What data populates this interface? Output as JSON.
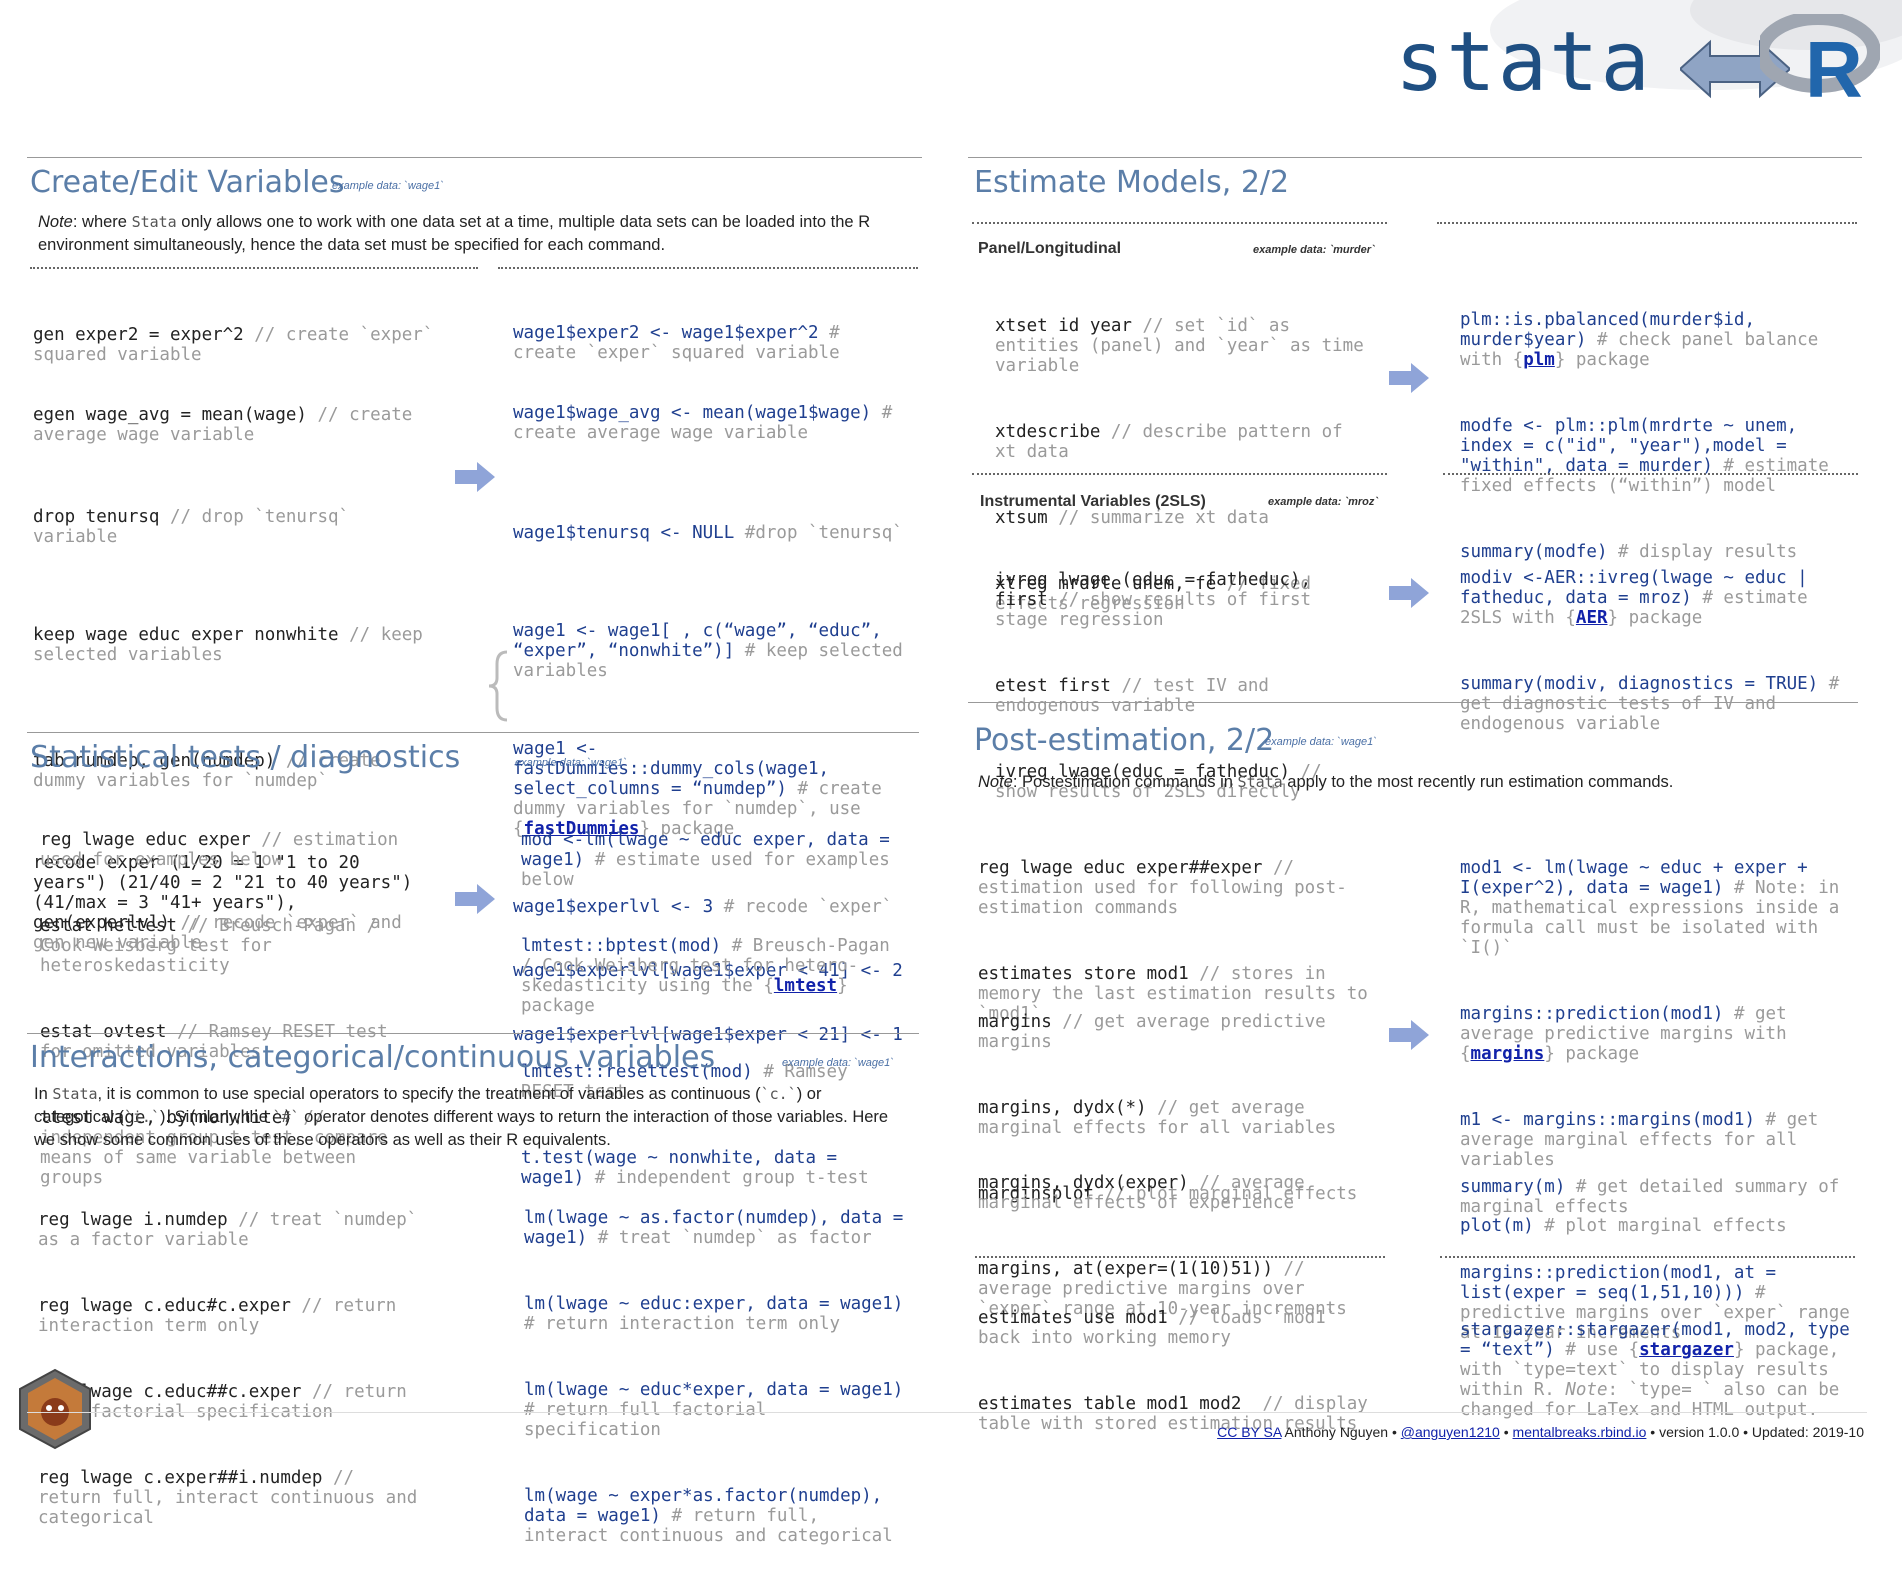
{
  "header": {
    "logo_text": "stata",
    "logo_r": "R"
  },
  "create": {
    "title": "Create/Edit Variables",
    "example": "example data: `wage1`",
    "note_label": "Note",
    "note_1": ": where ",
    "note_code": "Stata",
    "note_2": " only allows one to work with one data set at a time, multiple data sets can be loaded into the R environment simultaneously, hence the data set must be specified for each command.",
    "stata": [
      [
        "gen exper2 = exper^2",
        " // create `exper` squared variable"
      ],
      [
        "egen wage_avg = mean(wage)",
        " // create average wage variable"
      ],
      [
        "drop tenursq",
        " // drop `tenursq` variable"
      ],
      [
        "keep wage educ exper nonwhite",
        " // keep selected variables"
      ],
      [
        "tab numdep, gen(numdep)",
        " // create dummy variables for `numdep`"
      ],
      [
        "recode exper (1/20 = 1 \"1 to 20 years\") (21/40 = 2 \"21 to 40 years\") (41/max = 3 \"41+ years\"), gen(experlvl)",
        " // recode `exper` and gen new variable"
      ]
    ],
    "r": [
      [
        "wage1$exper2 <- wage1$exper^2",
        " # create `exper` squared variable"
      ],
      [
        "wage1$wage_avg <- mean(wage1$wage)",
        " # create average wage variable"
      ],
      [
        "wage1$tenursq <- NULL",
        " #drop `tenursq`"
      ],
      [
        "wage1 <- wage1[ , c(“wage”, “educ”, “exper”, “nonwhite”)]",
        " # keep selected variables"
      ],
      [
        "wage1 <- fastDummies::dummy_cols(wage1, select_columns = “numdep”)",
        " # create dummy variables for `numdep`, use {",
        "fastDummies",
        "} package"
      ],
      [
        "wage1$experlvl <- 3",
        " # recode `exper`"
      ],
      [
        "wage1$experlvl[wage1$exper < 41] <- 2",
        ""
      ],
      [
        "wage1$experlvl[wage1$exper < 21] <- 1",
        ""
      ]
    ]
  },
  "stats": {
    "title": "Statistical tests / diagnostics",
    "example": "example data: `wage1`",
    "stata": [
      [
        "reg lwage educ exper",
        " // estimation used for examples below"
      ],
      [
        "estat hettest",
        " // Breusch-Pagan / Cook-Weisberg test for heteroskedasticity"
      ],
      [
        "estat ovtest",
        " // Ramsey RESET test for omitted variables"
      ],
      [
        "ttest wage, by(nonwhite)",
        " // independent group t-test, compare means of same variable between groups"
      ]
    ],
    "r": [
      [
        "mod <-lm(lwage ~ educ exper, data = wage1)",
        " # estimate used for examples below"
      ],
      [
        "lmtest::bptest(mod)",
        " # Breusch-Pagan / Cook-Weisberg test for hetero-skedasticity using the {",
        "lmtest",
        "} package"
      ],
      [
        "lmtest::resettest(mod)",
        " # Ramsey RESET test"
      ],
      [
        "t.test(wage ~ nonwhite, data = wage1)",
        " # independent group t-test"
      ]
    ]
  },
  "inter": {
    "title": "Interactions, categorical/continuous variables",
    "example": "example data: `wage1`",
    "note_a": "In ",
    "note_code": "Stata",
    "note_b": ", it is common to use special operators to specify the treatment of variables as continuous (",
    "note_c": "`c.`",
    "note_d": ") or categorical (",
    "note_e": "`i.`",
    "note_f": ").  Similarly, the ",
    "note_g": "`#`",
    "note_h": " operator denotes different ways to return the interaction of those variables. Here we show some common uses of these operators as well as their R equivalents.",
    "stata": [
      [
        "reg lwage i.numdep",
        " // treat `numdep` as a factor variable"
      ],
      [
        "reg lwage c.educ#c.exper",
        " // return interaction term only"
      ],
      [
        "reg lwage c.educ##c.exper",
        " // return full factorial specification"
      ],
      [
        "reg lwage c.exper##i.numdep",
        " // return full, interact continuous and categorical"
      ]
    ],
    "r": [
      [
        "lm(lwage ~ as.factor(numdep), data = wage1)",
        " # treat `numdep` as factor"
      ],
      [
        "lm(lwage ~ educ:exper, data = wage1)",
        " # return interaction term only"
      ],
      [
        "lm(lwage ~ educ*exper, data = wage1)",
        " # return full factorial specification"
      ],
      [
        "lm(wage ~ exper*as.factor(numdep), data = wage1)",
        " # return full, interact continuous and categorical"
      ]
    ]
  },
  "models": {
    "title": "Estimate Models, 2/2",
    "panel_head": "Panel/Longitudinal",
    "panel_example": "example data: `murder`",
    "panel_stata": [
      [
        "xtset id year",
        " // set `id` as entities (panel) and `year` as time variable"
      ],
      [
        "xtdescribe",
        " // describe pattern of xt data"
      ],
      [
        "xtsum",
        " // summarize xt data"
      ],
      [
        "xtreg mrdrte unem, fe",
        " // fixed effects regression"
      ]
    ],
    "panel_r": [
      [
        "plm::is.pbalanced(murder$id, murder$year)",
        " # check panel balance with {",
        "plm",
        "} package"
      ],
      [
        "modfe <- plm::plm(mrdrte ~ unem, index = c(\"id\", \"year\"),model = \"within\", data = murder)",
        " # estimate fixed effects (“within”) model"
      ],
      [
        "summary(modfe)",
        " # display results"
      ]
    ],
    "iv_head": "Instrumental Variables (2SLS)",
    "iv_example": "example data: `mroz`",
    "iv_stata": [
      [
        "ivreg lwage (educ = fatheduc), first",
        " // show results of first stage regression"
      ],
      [
        "etest first",
        " // test IV and endogenous variable"
      ],
      [
        "ivreg lwage(educ = fatheduc)",
        " // show results of 2SLS directly"
      ]
    ],
    "iv_r": [
      [
        "modiv <-AER::ivreg(lwage ~ educ | fatheduc, data = mroz)",
        " # estimate 2SLS with {",
        "AER",
        "} package"
      ],
      [
        "summary(modiv, diagnostics = TRUE)",
        " # get diagnostic tests of IV and endogenous variable"
      ]
    ]
  },
  "post": {
    "title": "Post-estimation, 2/2",
    "example": "example data: `wage1`",
    "note_label": "Note",
    "note_1": ":  Postestimation commands in ",
    "note_code": "Stata",
    "note_2": "  apply to the most recently run estimation commands.",
    "s1": [
      [
        "reg lwage educ exper##exper",
        " // estimation used for following post-estimation commands"
      ],
      [
        "estimates store mod1",
        " // stores in memory the last estimation results to `mod1`"
      ]
    ],
    "r1": [
      [
        "mod1 <- lm(lwage ~ educ + exper + I(exper^2), data = wage1)",
        " # Note: in R, mathematical expressions inside a formula call must be isolated with `I()`"
      ]
    ],
    "s2": [
      [
        "margins",
        " // get average predictive margins"
      ],
      [
        "margins, dydx(*)",
        " // get average marginal effects for all variables"
      ],
      [
        "marginsplot",
        " // plot marginal effects"
      ]
    ],
    "r2": [
      [
        "margins::prediction(mod1)",
        " # get average predictive margins with {",
        "margins",
        "} package"
      ],
      [
        "m1 <- margins::margins(mod1)",
        " # get average marginal effects for all variables"
      ],
      [
        "plot(m)",
        " # plot marginal effects"
      ]
    ],
    "s3": [
      [
        "margins, dydx(exper)",
        " // average marginal effects of experience"
      ],
      [
        "margins, at(exper=(1(10)51))",
        " // average predictive margins over `exper` range at 10-year increments"
      ]
    ],
    "r3": [
      [
        "summary(m)",
        " # get detailed summary of marginal effects"
      ],
      [
        "margins::prediction(mod1, at = list(exper = seq(1,51,10)))",
        " # predictive margins over `exper` range at 10-year increments"
      ]
    ],
    "s4": [
      [
        "estimates use mod1",
        " // loads `mod1` back into working memory"
      ],
      [
        "estimates table mod1 mod2",
        "  // display table with stored estimation results"
      ]
    ],
    "r4": [
      [
        "stargazer::stargazer(mod1, mod2, type = “text”)",
        " # use {",
        "stargazer",
        "} package, with `type=text` to display results within R. ",
        "Note",
        ": `type= ` also can be changed for LaTex and HTML output."
      ]
    ]
  },
  "footer": {
    "license": "CC BY SA",
    "author": " Anthony Nguyen •  ",
    "twitter": "@anguyen1210",
    "sep1": " • ",
    "site": "mentalbreaks.rbind.io",
    "rest": " •  version 1.0.0 •  Updated: 2019-10"
  }
}
